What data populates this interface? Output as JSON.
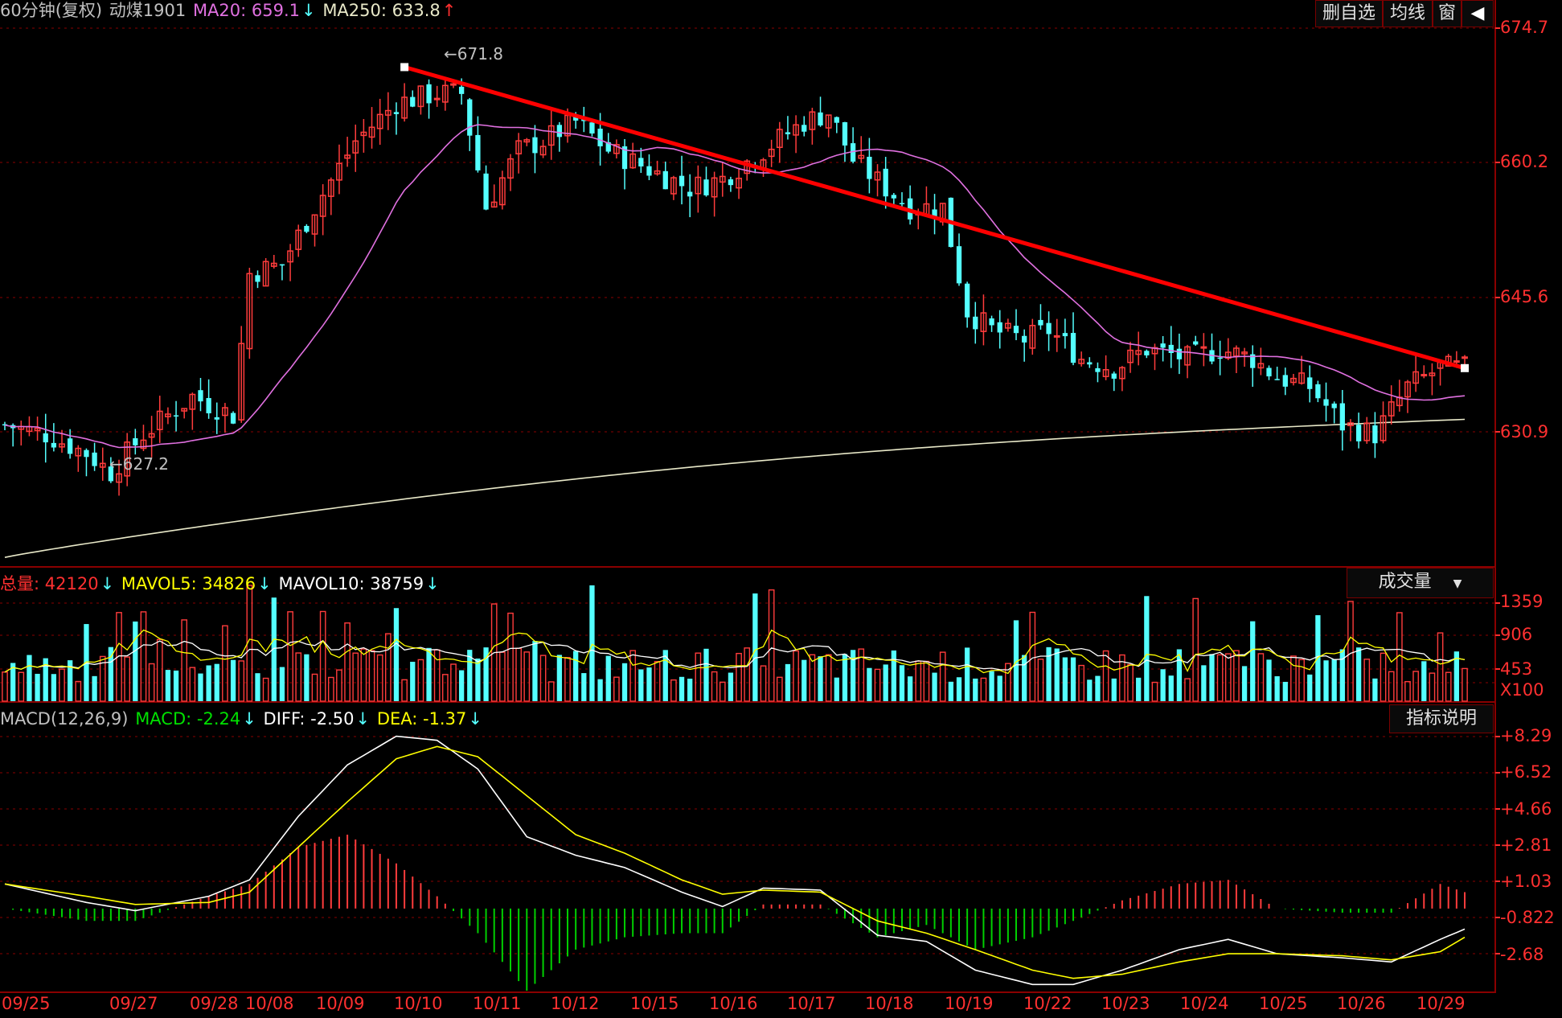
{
  "header": {
    "period": "60分钟(复权)",
    "symbol": "动煤1901",
    "ma20_label": "MA20: 659.1",
    "ma20_arrow": "↓",
    "ma250_label": "MA250: 633.8",
    "ma250_arrow": "↑"
  },
  "toolbar": {
    "btn1": "删自选",
    "btn2": "均线",
    "btn3": "窗",
    "btn4": "◀"
  },
  "price_axis": [
    "674.7",
    "660.2",
    "645.6",
    "630.9"
  ],
  "annotations": {
    "high": "671.8",
    "low": "627.2"
  },
  "volume_header": {
    "total": "总量: 42120",
    "mavol5": "MAVOL5: 34826",
    "mavol10": "MAVOL10: 38759",
    "arrow": "↓",
    "dropdown": "成交量"
  },
  "volume_axis": [
    "1359",
    "906",
    "453",
    "X100"
  ],
  "macd_header": {
    "name": "MACD(12,26,9)",
    "macd": "MACD: -2.24",
    "diff": "DIFF: -2.50",
    "dea": "DEA: -1.37",
    "arrow": "↓",
    "button": "指标说明"
  },
  "macd_axis": [
    "+8.29",
    "+6.52",
    "+4.66",
    "+2.81",
    "+1.03",
    "-0.822",
    "-2.68"
  ],
  "dates": [
    "09/25",
    "09/27",
    "09/28",
    "10/08",
    "10/09",
    "10/10",
    "10/11",
    "10/12",
    "10/15",
    "10/16",
    "10/17",
    "10/18",
    "10/19",
    "10/22",
    "10/23",
    "10/24",
    "10/25",
    "10/26",
    "10/29"
  ],
  "colors": {
    "up": "#ff3c3c",
    "down": "#54ffff",
    "ma20": "#e070e0",
    "ma250": "#e8e8c8",
    "trend": "#ff0000",
    "grid": "#8a0000",
    "diff": "#ffffff",
    "dea": "#ffff00"
  },
  "chart_data": {
    "type": "candlestick",
    "bars_count": 180,
    "price_range": [
      619,
      676
    ],
    "keypoints_close": [
      [
        0,
        634
      ],
      [
        5,
        633
      ],
      [
        10,
        631
      ],
      [
        13,
        629
      ],
      [
        17,
        633
      ],
      [
        23,
        637
      ],
      [
        28,
        635
      ],
      [
        30,
        650
      ],
      [
        34,
        651
      ],
      [
        38,
        657
      ],
      [
        43,
        664
      ],
      [
        48,
        668
      ],
      [
        53,
        669
      ],
      [
        56,
        669
      ],
      [
        59,
        657
      ],
      [
        63,
        663
      ],
      [
        66,
        664
      ],
      [
        70,
        666
      ],
      [
        74,
        663
      ],
      [
        79,
        661
      ],
      [
        84,
        659
      ],
      [
        88,
        660
      ],
      [
        93,
        663
      ],
      [
        98,
        666
      ],
      [
        101,
        667
      ],
      [
        104,
        662
      ],
      [
        108,
        659
      ],
      [
        111,
        657
      ],
      [
        115,
        657
      ],
      [
        118,
        646
      ],
      [
        121,
        644
      ],
      [
        125,
        643
      ],
      [
        128,
        644
      ],
      [
        132,
        641
      ],
      [
        136,
        640
      ],
      [
        140,
        642
      ],
      [
        145,
        641
      ],
      [
        149,
        642
      ],
      [
        153,
        641
      ],
      [
        156,
        639
      ],
      [
        160,
        638
      ],
      [
        164,
        634
      ],
      [
        168,
        633
      ],
      [
        172,
        638
      ],
      [
        176,
        640
      ],
      [
        179,
        640
      ]
    ],
    "trendline": {
      "from": [
        49,
        671.8
      ],
      "to": [
        179,
        640
      ]
    },
    "volume_range": [
      0,
      1359
    ],
    "macd_range": [
      -4,
      8.5
    ],
    "diff_keypoints": [
      [
        0,
        1.2
      ],
      [
        10,
        0.3
      ],
      [
        16,
        -0.1
      ],
      [
        25,
        0.6
      ],
      [
        30,
        1.4
      ],
      [
        36,
        4.5
      ],
      [
        42,
        7.0
      ],
      [
        48,
        8.4
      ],
      [
        53,
        8.2
      ],
      [
        58,
        6.8
      ],
      [
        64,
        3.5
      ],
      [
        70,
        2.6
      ],
      [
        76,
        2.0
      ],
      [
        83,
        0.8
      ],
      [
        88,
        0.1
      ],
      [
        93,
        1.0
      ],
      [
        100,
        0.9
      ],
      [
        107,
        -1.3
      ],
      [
        113,
        -1.6
      ],
      [
        119,
        -3.0
      ],
      [
        126,
        -3.7
      ],
      [
        131,
        -3.7
      ],
      [
        137,
        -3.0
      ],
      [
        144,
        -2.0
      ],
      [
        150,
        -1.5
      ],
      [
        156,
        -2.2
      ],
      [
        164,
        -2.4
      ],
      [
        170,
        -2.6
      ],
      [
        176,
        -1.5
      ],
      [
        179,
        -1.0
      ]
    ],
    "dea_keypoints": [
      [
        0,
        1.2
      ],
      [
        10,
        0.6
      ],
      [
        16,
        0.2
      ],
      [
        25,
        0.3
      ],
      [
        30,
        0.8
      ],
      [
        36,
        3.0
      ],
      [
        42,
        5.2
      ],
      [
        48,
        7.3
      ],
      [
        53,
        7.9
      ],
      [
        58,
        7.4
      ],
      [
        64,
        5.5
      ],
      [
        70,
        3.6
      ],
      [
        76,
        2.7
      ],
      [
        83,
        1.4
      ],
      [
        88,
        0.7
      ],
      [
        93,
        0.9
      ],
      [
        100,
        0.8
      ],
      [
        107,
        -0.6
      ],
      [
        113,
        -1.2
      ],
      [
        119,
        -2.0
      ],
      [
        126,
        -3.0
      ],
      [
        131,
        -3.4
      ],
      [
        137,
        -3.2
      ],
      [
        144,
        -2.6
      ],
      [
        150,
        -2.2
      ],
      [
        156,
        -2.2
      ],
      [
        164,
        -2.3
      ],
      [
        170,
        -2.5
      ],
      [
        176,
        -2.1
      ],
      [
        179,
        -1.4
      ]
    ]
  }
}
